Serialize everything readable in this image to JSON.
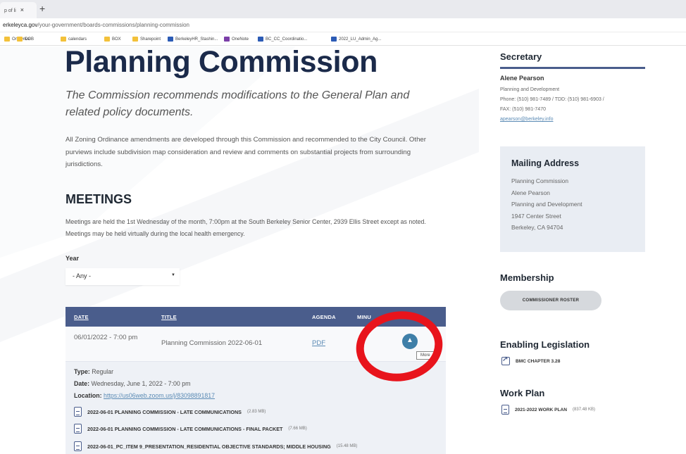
{
  "browser": {
    "tab_label": "p of li",
    "tab_close": "×",
    "new_tab": "+",
    "url_host": "erkeleyca.gov",
    "url_path": "/your-government/boards-commissions/planning-commission",
    "bookmarks": [
      {
        "label": "OneDrive",
        "icon": "folder"
      },
      {
        "label": "COB",
        "icon": "folder"
      },
      {
        "label": "calendars",
        "icon": "folder"
      },
      {
        "label": "BOX",
        "icon": "folder"
      },
      {
        "label": "Sharepoint",
        "icon": "folder"
      },
      {
        "label": "BerkeleyHR_Stashin...",
        "icon": "ms"
      },
      {
        "label": "OneNote",
        "icon": "on"
      },
      {
        "label": "BC_CC_Coordinatio...",
        "icon": "ms"
      },
      {
        "label": "2022_LU_Admin_Ag...",
        "icon": "ms"
      }
    ]
  },
  "page": {
    "title": "Planning Commission",
    "intro": "The Commission recommends modifications to the General Plan and related policy documents.",
    "description": "All Zoning Ordinance amendments are developed through this Commission and recommended to the City Council. Other purviews include subdivision map consideration and review and comments on substantial projects from surrounding jurisdictions."
  },
  "meetings": {
    "heading": "MEETINGS",
    "description": "Meetings are held the 1st Wednesday of the month, 7:00pm at the South Berkeley Senior Center, 2939 Ellis Street except as noted. Meetings may be held virtually during the local health emergency.",
    "year_label": "Year",
    "year_value": "- Any -",
    "columns": {
      "date": "DATE",
      "title": "TITLE",
      "agenda": "AGENDA",
      "minutes": "MINU"
    },
    "row": {
      "date": "06/01/2022 - 7:00 pm",
      "title": "Planning Commission 2022-06-01",
      "agenda": "PDF",
      "more_tooltip": "More"
    },
    "detail": {
      "type_label": "Type:",
      "type_value": "Regular",
      "date_label": "Date:",
      "date_value": "Wednesday, June 1, 2022 - 7:00 pm",
      "location_label": "Location:",
      "location_value": "https://us06web.zoom.us/j/83098891817"
    },
    "files": [
      {
        "name": "2022-06-01 PLANNING COMMISSION - LATE COMMUNICATIONS",
        "size": "(2.83 MB)"
      },
      {
        "name": "2022-06-01 PLANNING COMMISSION - LATE COMMUNICATIONS - FINAL PACKET",
        "size": "(7.66 MB)"
      },
      {
        "name": "2022-06-01_PC_ITEM 9_PRESENTATION_RESIDENTIAL OBJECTIVE STANDARDS; MIDDLE HOUSING",
        "size": "(15.48 MB)"
      }
    ]
  },
  "sidebar": {
    "secretary_heading": "Secretary",
    "secretary_name": "Alene Pearson",
    "secretary_lines": [
      "Planning and Development",
      "Phone: (510) 981-7489 / TDD: (510) 981-6903 /",
      "FAX: (510) 981-7470"
    ],
    "secretary_link": "apearson@berkeley.info",
    "mailing_heading": "Mailing Address",
    "mailing_lines": [
      "Planning Commission",
      "Alene Pearson",
      "Planning and Development",
      "1947 Center Street",
      "Berkeley, CA 94704"
    ],
    "membership_heading": "Membership",
    "roster_button": "COMMISSIONER ROSTER",
    "legislation_heading": "Enabling Legislation",
    "bmc_link": "BMC CHAPTER 3.28",
    "workplan_heading": "Work Plan",
    "workplan_link": "2021-2022 WORK PLAN",
    "workplan_size": "(837.48 KB)"
  },
  "colors": {
    "title": "#1b2a4a",
    "table_header": "#4a5d8c",
    "link": "#5b8bb5",
    "annotation": "#e8141c"
  }
}
